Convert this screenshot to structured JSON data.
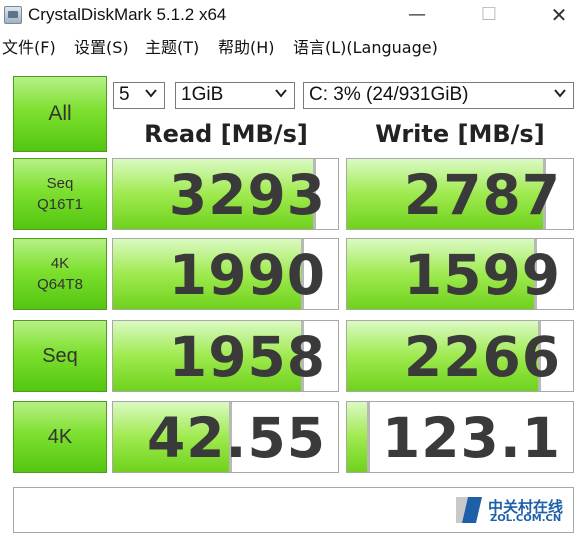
{
  "window": {
    "title": "CrystalDiskMark 5.1.2 x64",
    "minimize": "—",
    "maximize": "☐",
    "close": "✕"
  },
  "menu": [
    "文件(F)",
    "设置(S)",
    "主题(T)",
    "帮助(H)",
    "语言(L)(Language)"
  ],
  "controls": {
    "all_label": "All",
    "count": "5",
    "size": "1GiB",
    "drive": "C: 3% (24/931GiB)"
  },
  "headers": {
    "read": "Read [MB/s]",
    "write": "Write [MB/s]"
  },
  "tests": [
    {
      "label_line1": "Seq",
      "label_line2": "Q16T1",
      "read": "3293",
      "write": "2787",
      "read_fill": 0.9,
      "write_fill": 0.88
    },
    {
      "label_line1": "4K",
      "label_line2": "Q64T8",
      "read": "1990",
      "write": "1599",
      "read_fill": 0.85,
      "write_fill": 0.84
    },
    {
      "label_line1": "Seq",
      "label_line2": "",
      "read": "1958",
      "write": "2266",
      "read_fill": 0.85,
      "write_fill": 0.86
    },
    {
      "label_line1": "4K",
      "label_line2": "",
      "read": "42.55",
      "write": "123.1",
      "read_fill": 0.53,
      "write_fill": 0.1
    }
  ],
  "watermark": {
    "main": "中关村在线",
    "sub": "ZOL.COM.CN"
  },
  "colors": {
    "button_green": "#7ee02f",
    "bar_green": "#9fea4f",
    "watermark_blue": "#1d5fa8"
  }
}
